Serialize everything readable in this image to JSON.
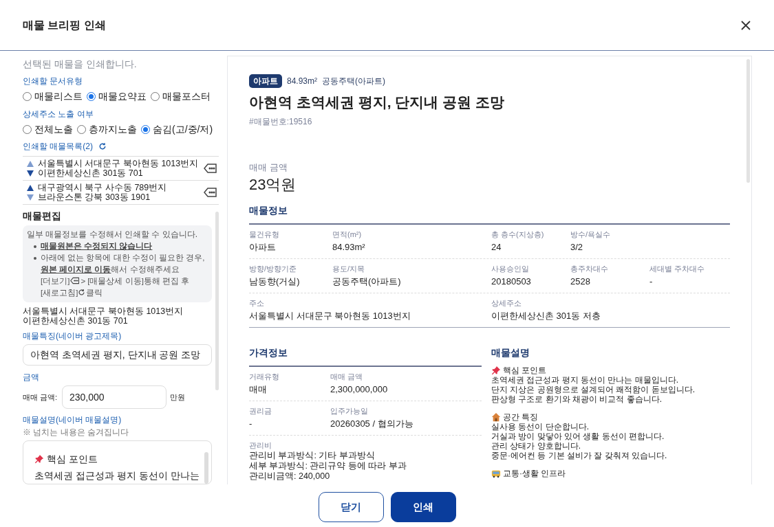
{
  "dialog": {
    "title": "매물 브리핑 인쇄"
  },
  "left": {
    "subtitle": "선택된 매물을 인쇄합니다.",
    "doc_type": {
      "label": "인쇄할 문서유형",
      "options": [
        {
          "label": "매물리스트",
          "selected": false
        },
        {
          "label": "매물요약표",
          "selected": true
        },
        {
          "label": "매물포스터",
          "selected": false
        }
      ]
    },
    "address_exposure": {
      "label": "상세주소 노출 여부",
      "options": [
        {
          "label": "전체노출",
          "selected": false
        },
        {
          "label": "층까지노출",
          "selected": false
        },
        {
          "label": "숨김(고/중/저)",
          "selected": true
        }
      ]
    },
    "print_list": {
      "label": "인쇄할 매물목록(2)",
      "items": [
        {
          "address": "서울특별시 서대문구 북아현동 1013번지",
          "detail": "이편한세상신촌 301동 701",
          "up_disabled": true,
          "down_disabled": false
        },
        {
          "address": "대구광역시 북구 사수동 789번지",
          "detail": "브라운스톤 강북 303동 1901",
          "up_disabled": false,
          "down_disabled": true
        }
      ]
    },
    "edit": {
      "title": "매물편집",
      "notice_intro": "일부 매물정보를 수정해서 인쇄할 수 있습니다.",
      "bullets": [
        {
          "lines": [
            [
              {
                "kind": "link",
                "text": "매물원본은 수정되지 않습니다"
              }
            ]
          ]
        },
        {
          "lines": [
            [
              {
                "kind": "text",
                "text": "아래에 없는 항목에 대한 수정이 필요한 경우,"
              }
            ],
            [
              {
                "kind": "link",
                "text": "원본 페이지로 이동"
              },
              {
                "kind": "text",
                "text": "해서 수정해주세요"
              }
            ],
            [
              {
                "kind": "text",
                "text": "[더보기]"
              },
              {
                "kind": "more_icon"
              },
              {
                "kind": "text",
                "text": "> [매물상세 이동]통해 편집 후"
              }
            ],
            [
              {
                "kind": "text",
                "text": "[새로고침]"
              },
              {
                "kind": "refresh_icon"
              },
              {
                "kind": "text",
                "text": "클릭"
              }
            ]
          ]
        }
      ],
      "address_lines": [
        "서울특별시 서대문구 북아현동 1013번지",
        "이편한세상신촌 301동 701"
      ],
      "feature_label": "매물특징(네이버 광고제목)",
      "feature_value": "아현역 초역세권 평지, 단지내 공원 조망",
      "price_label": "금액",
      "price_field_label": "매매 금액:",
      "price_value": "230,000",
      "price_unit": "만원",
      "desc_label": "매물설명(네이버 매물설명)",
      "desc_note": "※ 넘치는 내용은 숨겨집니다",
      "desc_heading": "핵심 포인트",
      "desc_line": "초역세권 접근성과 평지 동선이 만나는"
    }
  },
  "preview": {
    "badge": "아파트",
    "area": "84.93m²",
    "usage": "공동주택(아파트)",
    "title": "아현역 초역세권 평지, 단지내 공원 조망",
    "listing_no": "#매물번호:19516",
    "price_label": "매매 금액",
    "price": "23억원",
    "info": {
      "title": "매물정보",
      "rows": [
        [
          {
            "label": "물건유형",
            "value": "아파트"
          },
          {
            "label": "면적(m²)",
            "value": "84.93m²"
          },
          {
            "label": "총 층수(지상층)",
            "value": "24"
          },
          {
            "label": "방수/욕실수",
            "value": "3/2"
          }
        ],
        [
          {
            "label": "방향/방향기준",
            "value": "남동향(거실)"
          },
          {
            "label": "용도/지목",
            "value": "공동주택(아파트)"
          },
          {
            "label": "사용승인일",
            "value": "20180503"
          },
          {
            "label": "총주차대수",
            "value": "2528"
          },
          {
            "label": "세대별 주차대수",
            "value": "-"
          }
        ],
        [
          {
            "label": "주소",
            "value": "서울특별시 서대문구 북아현동 1013번지"
          },
          "",
          {
            "label": "상세주소",
            "value": "이편한세상신촌 301동 저층"
          }
        ]
      ]
    },
    "price_info": {
      "title": "가격정보",
      "rows": [
        [
          {
            "label": "거래유형",
            "value": "매매"
          },
          {
            "label": "매매 금액",
            "value": "2,300,000,000"
          }
        ],
        [
          {
            "label": "권리금",
            "value": "-"
          },
          {
            "label": "입주가능일",
            "value": "20260305 / 협의가능"
          }
        ]
      ],
      "fee": {
        "label": "관리비",
        "lines": [
          "관리비 부과방식: 기타 부과방식",
          "세부 부과방식: 관리규약 등에 따라 부과",
          "관리비금액: 240,000"
        ]
      }
    },
    "description": {
      "title": "매물설명",
      "sections": [
        {
          "kind": "pin",
          "heading": "핵심 포인트",
          "lines": [
            "초역세권 접근성과 평지 동선이 만나는 매물입니다.",
            "단지 지상은 공원형으로 설계되어 쾌적함이 돋보입니다.",
            "판상형 구조로 환기와 채광이 비교적 좋습니다."
          ]
        },
        {
          "kind": "house",
          "heading": "공간 특징",
          "lines": [
            "실사용 동선이 단순합니다.",
            "거실과 방이 맞닿아 있어 생활 동선이 편합니다.",
            "관리 상태가 양호합니다.",
            "중문·에어컨 등 기본 설비가 잘 갖춰져 있습니다."
          ]
        },
        {
          "kind": "bus",
          "heading": "교통·생활 인프라"
        }
      ]
    }
  },
  "buttons": [
    {
      "kind": "secondary",
      "label": "닫기"
    },
    {
      "kind": "primary",
      "label": "인쇄"
    }
  ]
}
